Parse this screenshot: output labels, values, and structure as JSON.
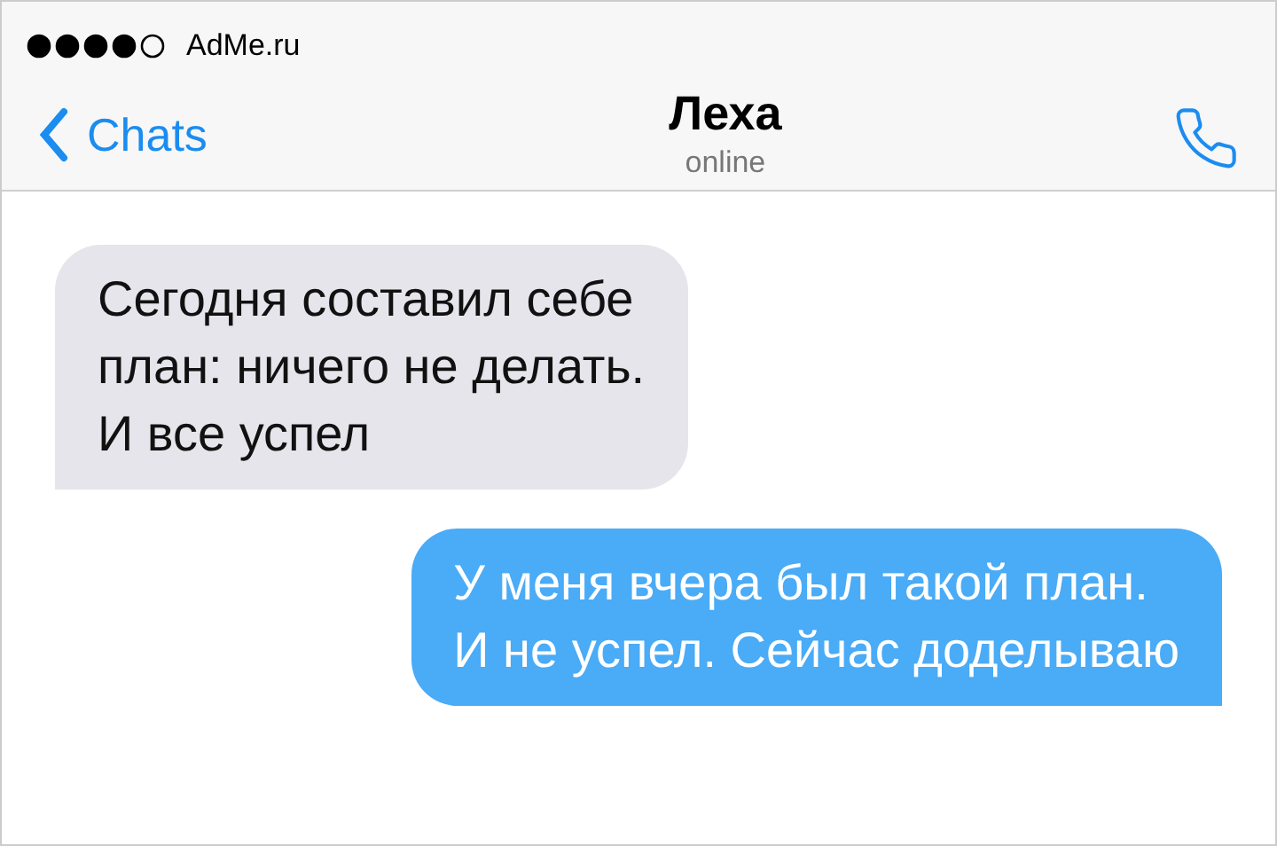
{
  "status_bar": {
    "carrier": "AdMe.ru"
  },
  "header": {
    "back": "Chats",
    "title": "Леха",
    "subtitle": "online"
  },
  "messages": [
    {
      "kind": "incoming",
      "text": "Сегодня составил себе\nплан: ничего не делать.\nИ все успел"
    },
    {
      "kind": "outgoing",
      "text": "У меня вчера был такой план.\nИ не успел. Сейчас доделываю"
    }
  ]
}
